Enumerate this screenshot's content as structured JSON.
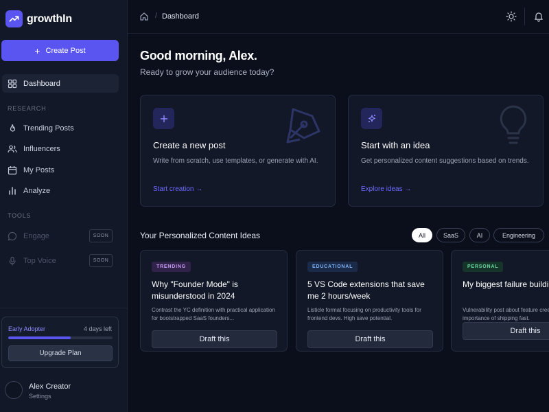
{
  "brand": {
    "name": "growthIn",
    "logo_icon": "trend-up-icon",
    "accent": "#5a55f0"
  },
  "sidebar": {
    "create_label": "Create Post",
    "dashboard_label": "Dashboard",
    "research_label": "RESEARCH",
    "research_items": [
      {
        "label": "Trending Posts",
        "icon": "flame-icon"
      },
      {
        "label": "Influencers",
        "icon": "users-icon"
      },
      {
        "label": "My Posts",
        "icon": "calendar-icon"
      },
      {
        "label": "Analyze",
        "icon": "bar-chart-icon"
      }
    ],
    "tools_label": "TOOLS",
    "tools_items": [
      {
        "label": "Engage",
        "icon": "chat-bubble-icon",
        "badge": "SOON"
      },
      {
        "label": "Top Voice",
        "icon": "microphone-icon",
        "badge": "SOON"
      }
    ],
    "plan": {
      "title": "Early Adopter",
      "days_left": "4 days left",
      "progress": 0.6,
      "button": "Upgrade Plan"
    },
    "user": {
      "name": "Alex Creator",
      "sub": "Settings"
    }
  },
  "header": {
    "breadcrumb": "Dashboard",
    "home_icon": "home-icon",
    "theme_icon": "sun-icon",
    "notif_icon": "bell-icon"
  },
  "main": {
    "greeting": "Good morning, Alex.",
    "subtitle": "Ready to grow your audience today?",
    "cards": [
      {
        "icon": "plus-icon",
        "title": "Create a new post",
        "desc": "Write from scratch, use templates, or generate with AI.",
        "link": "Start creation"
      },
      {
        "icon": "sparkles-icon",
        "title": "Start with an idea",
        "desc": "Get personalized content suggestions based on trends.",
        "link": "Explore ideas"
      }
    ],
    "ideas_title": "Your Personalized Content Ideas",
    "filters": [
      "All",
      "SaaS",
      "AI",
      "Engineering"
    ],
    "active_filter": "All",
    "ideas": [
      {
        "badge": "TRENDING",
        "title": "Why \"Founder Mode\" is misunderstood in 2024",
        "desc": "Contrast the YC definition with practical application for bootstrapped SaaS founders...",
        "button": "Draft this"
      },
      {
        "badge": "EDUCATIONAL",
        "title": "5 VS Code extensions that save me 2 hours/week",
        "desc": "Listicle format focusing on productivity tools for frontend devs. High save potential.",
        "button": "Draft this"
      },
      {
        "badge": "PERSONAL",
        "title": "My biggest failure building an MVP",
        "desc": "Vulnerability post about feature creep. Discuss the importance of shipping fast.",
        "button": "Draft this"
      }
    ]
  }
}
